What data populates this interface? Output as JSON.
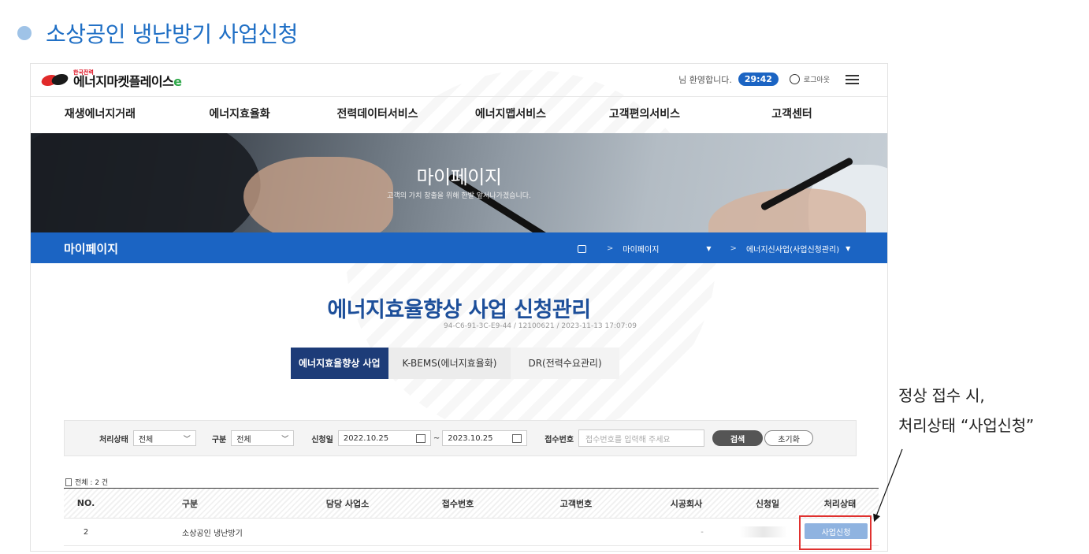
{
  "slide": {
    "title": "소상공인 냉난방기 사업신청"
  },
  "header": {
    "logo_small": "한국전력",
    "logo_name": "에너지마켓플레이스",
    "logo_mark": "e",
    "welcome": "님 환영합니다.",
    "timer": "29:42",
    "logout": "로그아웃"
  },
  "gnb": [
    "재생에너지거래",
    "에너지효율화",
    "전력데이터서비스",
    "에너지맵서비스",
    "고객편의서비스",
    "고객센터"
  ],
  "hero": {
    "title": "마이페이지",
    "subtitle": "고객의 가치 창출을 위해 한발 앞서나가겠습니다."
  },
  "location": {
    "title": "마이페이지",
    "crumb1": "마이페이지",
    "crumb2": "에너지신사업(사업신청관리)"
  },
  "page": {
    "heading": "에너지효율향상 사업 신청관리",
    "pc_id": "94-C6-91-3C-E9-44 / 12100621 / 2023-11-13 17:07:09"
  },
  "tabs": [
    "에너지효율향상 사업",
    "K-BEMS(에너지효율화)",
    "DR(전력수요관리)"
  ],
  "search": {
    "status_label": "처리상태",
    "status_value": "전체",
    "type_label": "구분",
    "type_value": "전체",
    "date_label": "신청일",
    "date_from": "2022.10.25",
    "date_sep": "~",
    "date_to": "2023.10.25",
    "receipt_label": "접수번호",
    "receipt_placeholder": "접수번호를 입력해 주세요",
    "search_btn": "검색",
    "reset_btn": "초기화"
  },
  "table": {
    "total": "전체 : 2 건",
    "headers": [
      "NO.",
      "구분",
      "담당 사업소",
      "접수번호",
      "고객번호",
      "시공회사",
      "신청일",
      "처리상태"
    ],
    "row": {
      "no": "2",
      "type": "소상공인 냉난방기",
      "company": "-",
      "status": "사업신청"
    }
  },
  "callout": {
    "line1": "정상 접수 시,",
    "line2": "처리상태 “사업신청”"
  }
}
